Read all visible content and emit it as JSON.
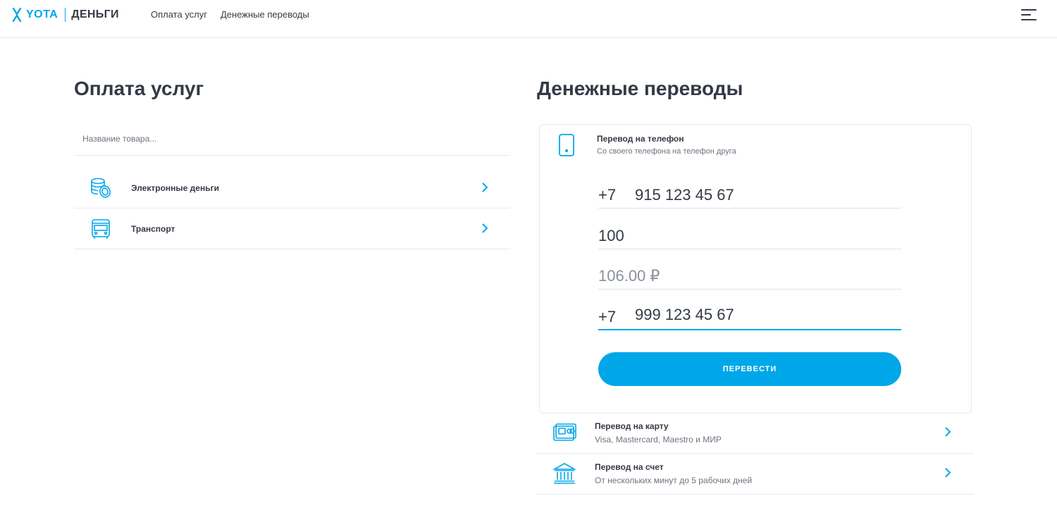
{
  "header": {
    "logo_brand": "YOTA",
    "logo_product": "ДЕНЬГИ",
    "nav": [
      "Оплата услуг",
      "Денежные переводы"
    ],
    "menu_icon": "hamburger-icon"
  },
  "services": {
    "title": "Оплата услуг",
    "search_placeholder": "Название товара...",
    "items": [
      {
        "label": "Электронные деньги",
        "icon": "coins-icon"
      },
      {
        "label": "Транспорт",
        "icon": "bus-icon"
      }
    ]
  },
  "transfers": {
    "title": "Денежные переводы",
    "phone_card": {
      "icon": "phone-icon",
      "title": "Перевод на телефон",
      "subtitle": "Со своего телефона на телефон друга",
      "from_prefix": "+7",
      "from_number": "915 123 45 67",
      "amount": "100",
      "total": "106.00 ₽",
      "to_prefix": "+7",
      "to_number": "999 123 45 67",
      "button_label": "ПЕРЕВЕСТИ"
    },
    "items": [
      {
        "title": "Перевод на карту",
        "subtitle": "Visa, Mastercard, Maestro и МИР",
        "icon": "card-icon"
      },
      {
        "title": "Перевод на счет",
        "subtitle": "От нескольких минут до 5 рабочих дней",
        "icon": "bank-icon"
      }
    ]
  },
  "colors": {
    "accent": "#00a7e8",
    "text": "#333a45",
    "muted": "#6c7480",
    "divider": "#e8eaed"
  }
}
